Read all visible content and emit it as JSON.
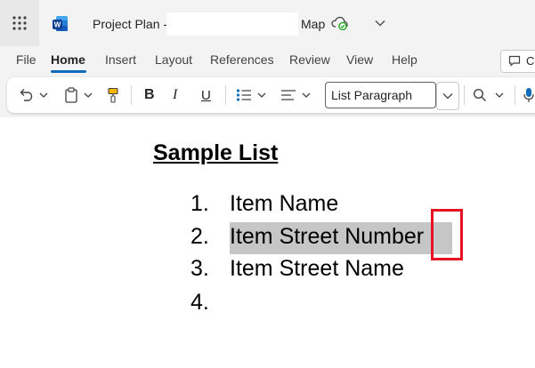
{
  "title_bar": {
    "doc_title_prefix": "Project Plan -",
    "doc_title_suffix": "Map"
  },
  "tabs": [
    {
      "label": "File"
    },
    {
      "label": "Home",
      "active": true
    },
    {
      "label": "Insert"
    },
    {
      "label": "Layout"
    },
    {
      "label": "References"
    },
    {
      "label": "Review"
    },
    {
      "label": "View"
    },
    {
      "label": "Help"
    }
  ],
  "comments_button": {
    "label": "Co"
  },
  "ribbon": {
    "undo_icon": "undo-icon",
    "paste_icon": "clipboard-icon",
    "format_painter_icon": "paintbrush-icon",
    "bold_label": "B",
    "italic_label": "I",
    "underline_label": "U",
    "bullets_icon": "bullet-list-icon",
    "align_icon": "align-left-icon",
    "style_value": "List Paragraph",
    "find_icon": "search-icon"
  },
  "document": {
    "heading": "Sample List",
    "list": [
      {
        "num": "1.",
        "text": "Item Name"
      },
      {
        "num": "2.",
        "text": "Item Street Number",
        "selected": true
      },
      {
        "num": "3.",
        "text": "Item Street Name"
      },
      {
        "num": "4.",
        "text": ""
      }
    ]
  },
  "colors": {
    "accent": "#0f6cbd",
    "selection": "#c6c6c6",
    "annotation": "#e81123"
  }
}
